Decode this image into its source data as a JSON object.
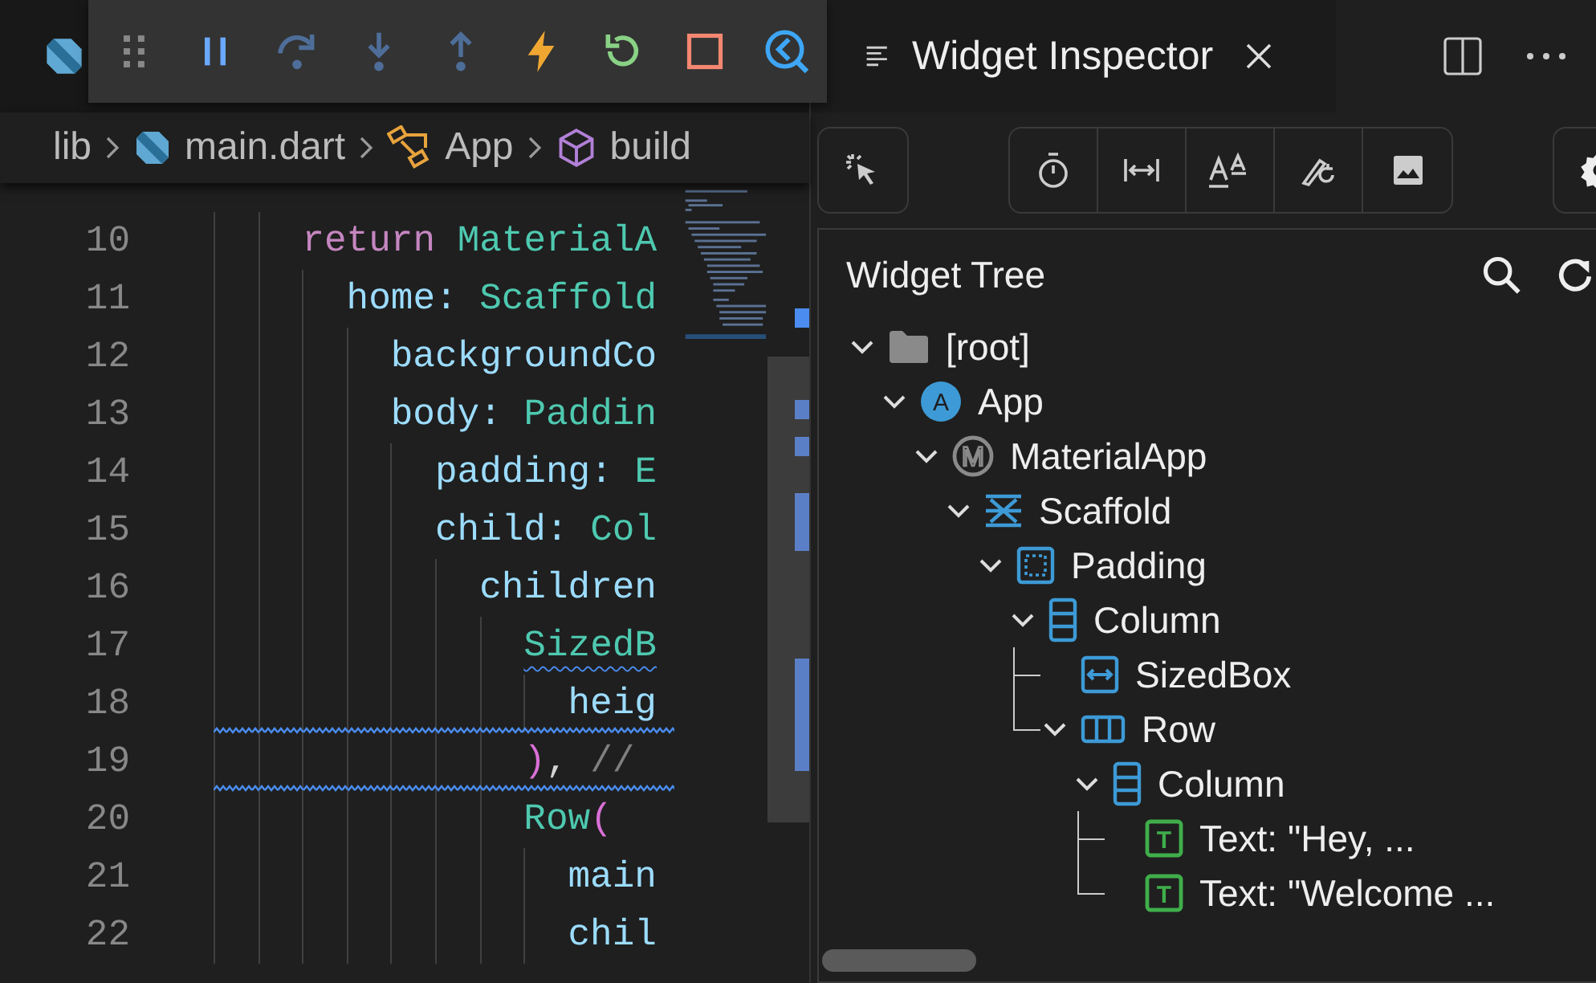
{
  "debug_toolbar": [
    {
      "kind": "grip"
    },
    {
      "kind": "pause",
      "disabled": false
    },
    {
      "kind": "step_over",
      "disabled": true
    },
    {
      "kind": "step_into",
      "disabled": true
    },
    {
      "kind": "step_out",
      "disabled": true
    },
    {
      "kind": "hot_reload",
      "disabled": false
    },
    {
      "kind": "restart",
      "disabled": false
    },
    {
      "kind": "stop",
      "disabled": false
    },
    {
      "kind": "inspector",
      "disabled": false
    }
  ],
  "breadcrumbs": [
    {
      "label": "lib",
      "kind": "folder"
    },
    {
      "label": "main.dart",
      "kind": "file"
    },
    {
      "label": "App",
      "kind": "class"
    },
    {
      "label": "build",
      "kind": "method"
    }
  ],
  "code_lines": [
    {
      "number": "10",
      "tokens": [
        {
          "text": "    return",
          "kind": "keyword"
        },
        {
          "text": " MaterialA",
          "kind": "type"
        }
      ]
    },
    {
      "number": "11",
      "tokens": [
        {
          "text": "      home:",
          "kind": "prop"
        },
        {
          "text": " Scaffold",
          "kind": "type"
        }
      ]
    },
    {
      "number": "12",
      "tokens": [
        {
          "text": "        backgroundCo",
          "kind": "prop"
        }
      ]
    },
    {
      "number": "13",
      "tokens": [
        {
          "text": "        body:",
          "kind": "prop"
        },
        {
          "text": " Paddin",
          "kind": "type"
        }
      ]
    },
    {
      "number": "14",
      "tokens": [
        {
          "text": "          padding:",
          "kind": "prop"
        },
        {
          "text": " E",
          "kind": "type"
        }
      ]
    },
    {
      "number": "15",
      "tokens": [
        {
          "text": "          child:",
          "kind": "prop"
        },
        {
          "text": " Col",
          "kind": "type"
        }
      ]
    },
    {
      "number": "16",
      "tokens": [
        {
          "text": "            children",
          "kind": "prop"
        }
      ]
    },
    {
      "number": "17",
      "tokens": [
        {
          "text": "              SizedB",
          "kind": "type",
          "warn": true
        }
      ]
    },
    {
      "number": "18",
      "warn": true,
      "tokens": [
        {
          "text": "                heig",
          "kind": "prop"
        }
      ]
    },
    {
      "number": "19",
      "warn": true,
      "tokens": [
        {
          "text": "              )",
          "kind": "paren"
        },
        {
          "text": ", ",
          "kind": "punct"
        },
        {
          "text": "//",
          "kind": "comment"
        }
      ]
    },
    {
      "number": "20",
      "tokens": [
        {
          "text": "              Row",
          "kind": "type"
        },
        {
          "text": "(",
          "kind": "paren"
        }
      ]
    },
    {
      "number": "21",
      "tokens": [
        {
          "text": "                main",
          "kind": "prop"
        }
      ]
    },
    {
      "number": "22",
      "tokens": [
        {
          "text": "                chil",
          "kind": "prop"
        }
      ]
    }
  ],
  "editor_tab": {
    "title": "Widget Inspector"
  },
  "inspector_toolbar": {
    "left": [
      {
        "kind": "select"
      }
    ],
    "middle": [
      {
        "kind": "timer"
      },
      {
        "kind": "width"
      },
      {
        "kind": "text_size"
      },
      {
        "kind": "repaint"
      },
      {
        "kind": "image"
      }
    ],
    "right": [
      {
        "kind": "settings"
      }
    ]
  },
  "widget_tree": {
    "title": "Widget Tree",
    "nodes": [
      {
        "label": "[root]",
        "kind": "folder",
        "expanded": true,
        "children": [
          {
            "label": "App",
            "kind": "app",
            "icon_letter": "A",
            "expanded": true,
            "children": [
              {
                "label": "MaterialApp",
                "kind": "material",
                "icon_letter": "M",
                "expanded": true,
                "children": [
                  {
                    "label": "Scaffold",
                    "kind": "scaffold",
                    "expanded": true,
                    "children": [
                      {
                        "label": "Padding",
                        "kind": "padding",
                        "expanded": true,
                        "children": [
                          {
                            "label": "Column",
                            "kind": "column",
                            "expanded": true,
                            "children": [
                              {
                                "label": "SizedBox",
                                "kind": "sizedbox"
                              },
                              {
                                "label": "Row",
                                "kind": "row",
                                "expanded": true,
                                "children": [
                                  {
                                    "label": "Column",
                                    "kind": "column",
                                    "expanded": true,
                                    "children": [
                                      {
                                        "label": "Text: \"Hey, ...",
                                        "kind": "text",
                                        "icon_letter": "T"
                                      },
                                      {
                                        "label": "Text: \"Welcome ...",
                                        "kind": "text",
                                        "icon_letter": "T"
                                      }
                                    ]
                                  }
                                ]
                              }
                            ]
                          }
                        ]
                      }
                    ]
                  }
                ]
              }
            ]
          }
        ]
      }
    ]
  }
}
